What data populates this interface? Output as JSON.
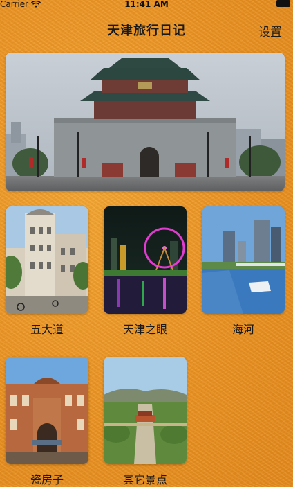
{
  "status_bar": {
    "carrier": "Carrier",
    "time": "11:41 AM"
  },
  "nav": {
    "title": "天津旅行日记",
    "settings_label": "设置"
  },
  "hero": {
    "icon": "drum-tower-photo"
  },
  "spots": [
    {
      "label": "五大道"
    },
    {
      "label": "天津之眼"
    },
    {
      "label": "海河"
    },
    {
      "label": "瓷房子"
    },
    {
      "label": "其它景点"
    }
  ],
  "colors": {
    "background": "#eb9221",
    "text": "#1a1a1a"
  }
}
